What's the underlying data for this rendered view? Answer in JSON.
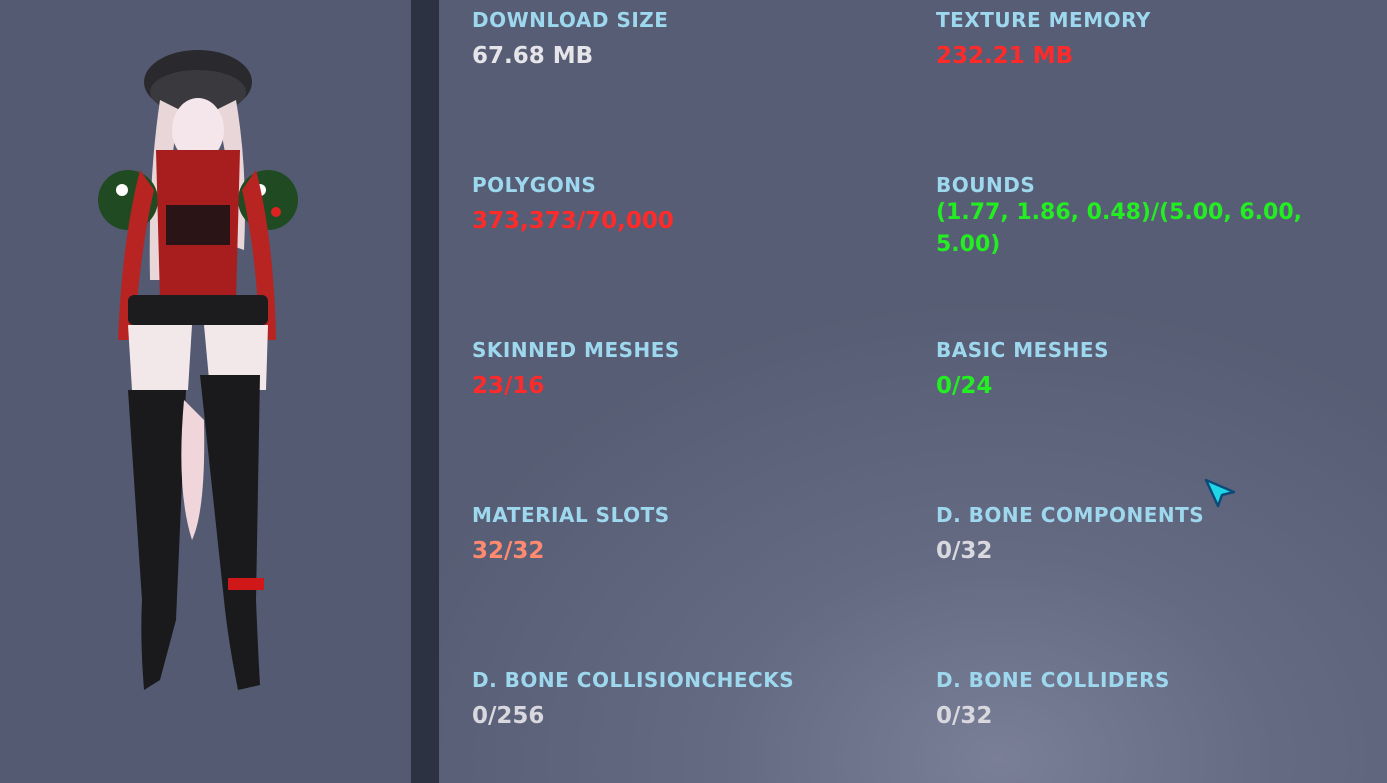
{
  "colors": {
    "label": "#9ed8ee",
    "neutral": "#e6e6ea",
    "bad": "#ff2a2a",
    "good": "#22ee22",
    "warn": "#ff8a70",
    "muted": "#d8d8de"
  },
  "stats": {
    "download_size": {
      "label": "DOWNLOAD SIZE",
      "value": "67.68 MB",
      "status": "neutral"
    },
    "texture_memory": {
      "label": "TEXTURE MEMORY",
      "value": "232.21 MB",
      "status": "bad"
    },
    "polygons": {
      "label": "POLYGONS",
      "value": "373,373/70,000",
      "status": "bad"
    },
    "bounds": {
      "label": "BOUNDS",
      "value": "(1.77, 1.86, 0.48)/(5.00, 6.00, 5.00)",
      "status": "good"
    },
    "skinned_meshes": {
      "label": "SKINNED MESHES",
      "value": "23/16",
      "status": "bad"
    },
    "basic_meshes": {
      "label": "BASIC MESHES",
      "value": "0/24",
      "status": "good"
    },
    "material_slots": {
      "label": "MATERIAL SLOTS",
      "value": "32/32",
      "status": "warn"
    },
    "d_bone_components": {
      "label": "D. BONE COMPONENTS",
      "value": "0/32",
      "status": "muted"
    },
    "d_bone_collisionchecks": {
      "label": "D. BONE COLLISIONCHECKS",
      "value": "0/256",
      "status": "muted"
    },
    "d_bone_colliders": {
      "label": "D. BONE COLLIDERS",
      "value": "0/32",
      "status": "muted"
    }
  },
  "avatar": {
    "icon": "avatar-preview"
  },
  "cursor": {
    "icon": "pointer-cursor-icon"
  }
}
